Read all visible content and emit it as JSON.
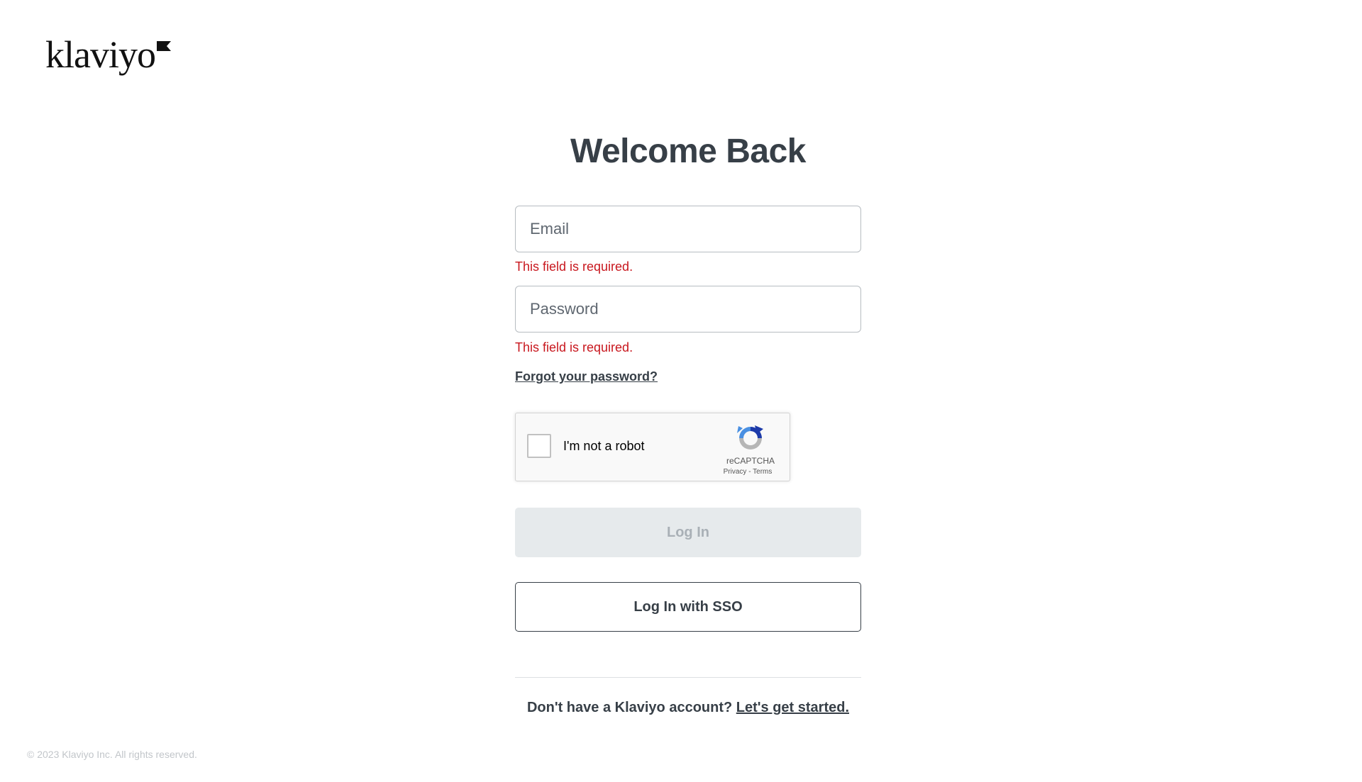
{
  "brand": {
    "logo_text": "klaviyo",
    "color": "#111111"
  },
  "form": {
    "title": "Welcome Back",
    "email": {
      "placeholder": "Email",
      "value": "",
      "error": "This field is required."
    },
    "password": {
      "placeholder": "Password",
      "value": "",
      "error": "This field is required."
    },
    "forgot_label": "Forgot your password?",
    "login_label": "Log In",
    "sso_label": "Log In with SSO"
  },
  "recaptcha": {
    "label": "I'm not a robot",
    "brand": "reCAPTCHA",
    "privacy": "Privacy",
    "separator": " - ",
    "terms": "Terms",
    "checked": false
  },
  "signup": {
    "prompt": "Don't have a Klaviyo account?",
    "link": "Let's get started."
  },
  "footer": {
    "copyright": "© 2023 Klaviyo Inc. All rights reserved."
  },
  "colors": {
    "error": "#c8171e",
    "text": "#373f47",
    "disabled_bg": "#e6eaec",
    "disabled_text": "#a9b0b6"
  }
}
